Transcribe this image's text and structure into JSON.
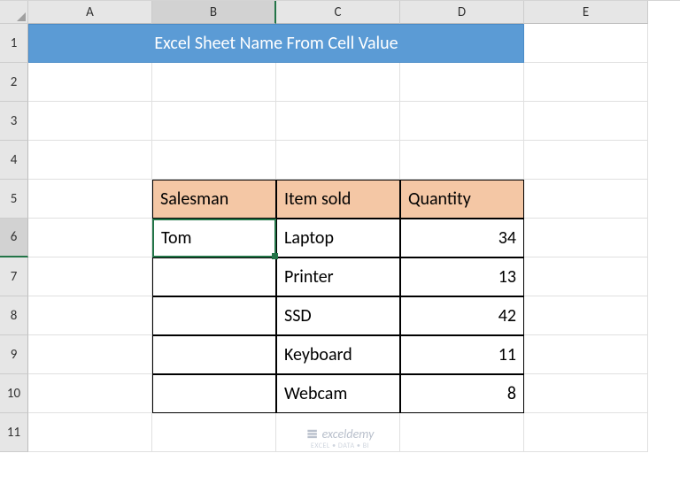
{
  "columns": [
    "A",
    "B",
    "C",
    "D",
    "E"
  ],
  "row_count": 11,
  "title": "Excel Sheet Name From Cell Value",
  "table": {
    "headers": {
      "salesman": "Salesman",
      "item_sold": "Item sold",
      "quantity": "Quantity"
    },
    "salesman": "Tom",
    "rows": [
      {
        "item": "Laptop",
        "qty": "34"
      },
      {
        "item": "Printer",
        "qty": "13"
      },
      {
        "item": "SSD",
        "qty": "42"
      },
      {
        "item": "Keyboard",
        "qty": "11"
      },
      {
        "item": "Webcam",
        "qty": "8"
      }
    ]
  },
  "selected_cell": "B6",
  "watermark": {
    "text": "exceldemy",
    "subtitle": "EXCEL • DATA • BI"
  }
}
